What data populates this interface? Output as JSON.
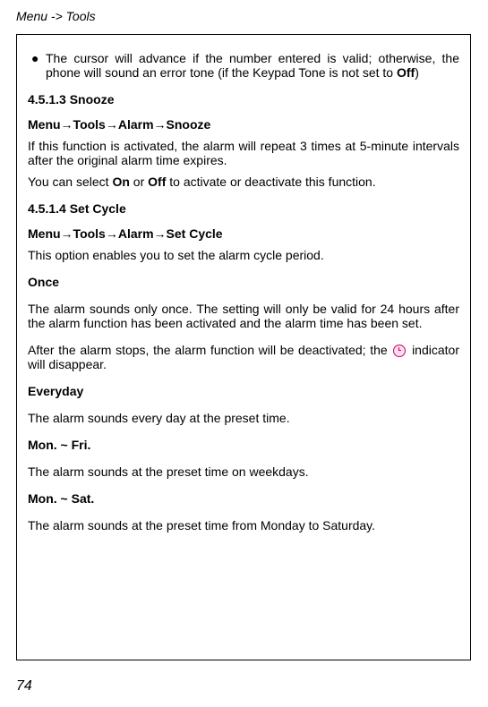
{
  "header": "Menu -> Tools",
  "bullet": {
    "marker": "●",
    "text_before": "The cursor will advance if the number entered is valid; otherwise, the phone will sound an error tone (if the Keypad Tone is not set to ",
    "bold": "Off",
    "text_after": ")"
  },
  "snooze": {
    "heading": "4.5.1.3 Snooze",
    "path": "Menu→Tools→Alarm→Snooze",
    "para1": "If this function is activated, the alarm will repeat 3 times at 5-minute intervals after the original alarm time expires.",
    "para2_before": "You can select ",
    "para2_b1": "On",
    "para2_mid": " or ",
    "para2_b2": "Off",
    "para2_after": " to activate or deactivate this function."
  },
  "setcycle": {
    "heading": "4.5.1.4 Set Cycle",
    "path": "Menu→Tools→Alarm→Set Cycle",
    "para": "This option enables you to set the alarm cycle period."
  },
  "once": {
    "heading": "Once",
    "para1": "The alarm sounds only once. The setting will only be valid for 24 hours after the alarm function has been activated and the alarm time has been set.",
    "para2_before": "After the alarm stops, the alarm function will be deactivated; the ",
    "para2_after": " indicator will disappear."
  },
  "everyday": {
    "heading": "Everyday",
    "para": "The alarm sounds every day at the preset time."
  },
  "monfri": {
    "heading": "Mon. ~ Fri.",
    "para": "The alarm sounds at the preset time on weekdays."
  },
  "monsat": {
    "heading": "Mon. ~ Sat.",
    "para": "The alarm sounds at the preset time from Monday to Saturday."
  },
  "page_number": "74"
}
